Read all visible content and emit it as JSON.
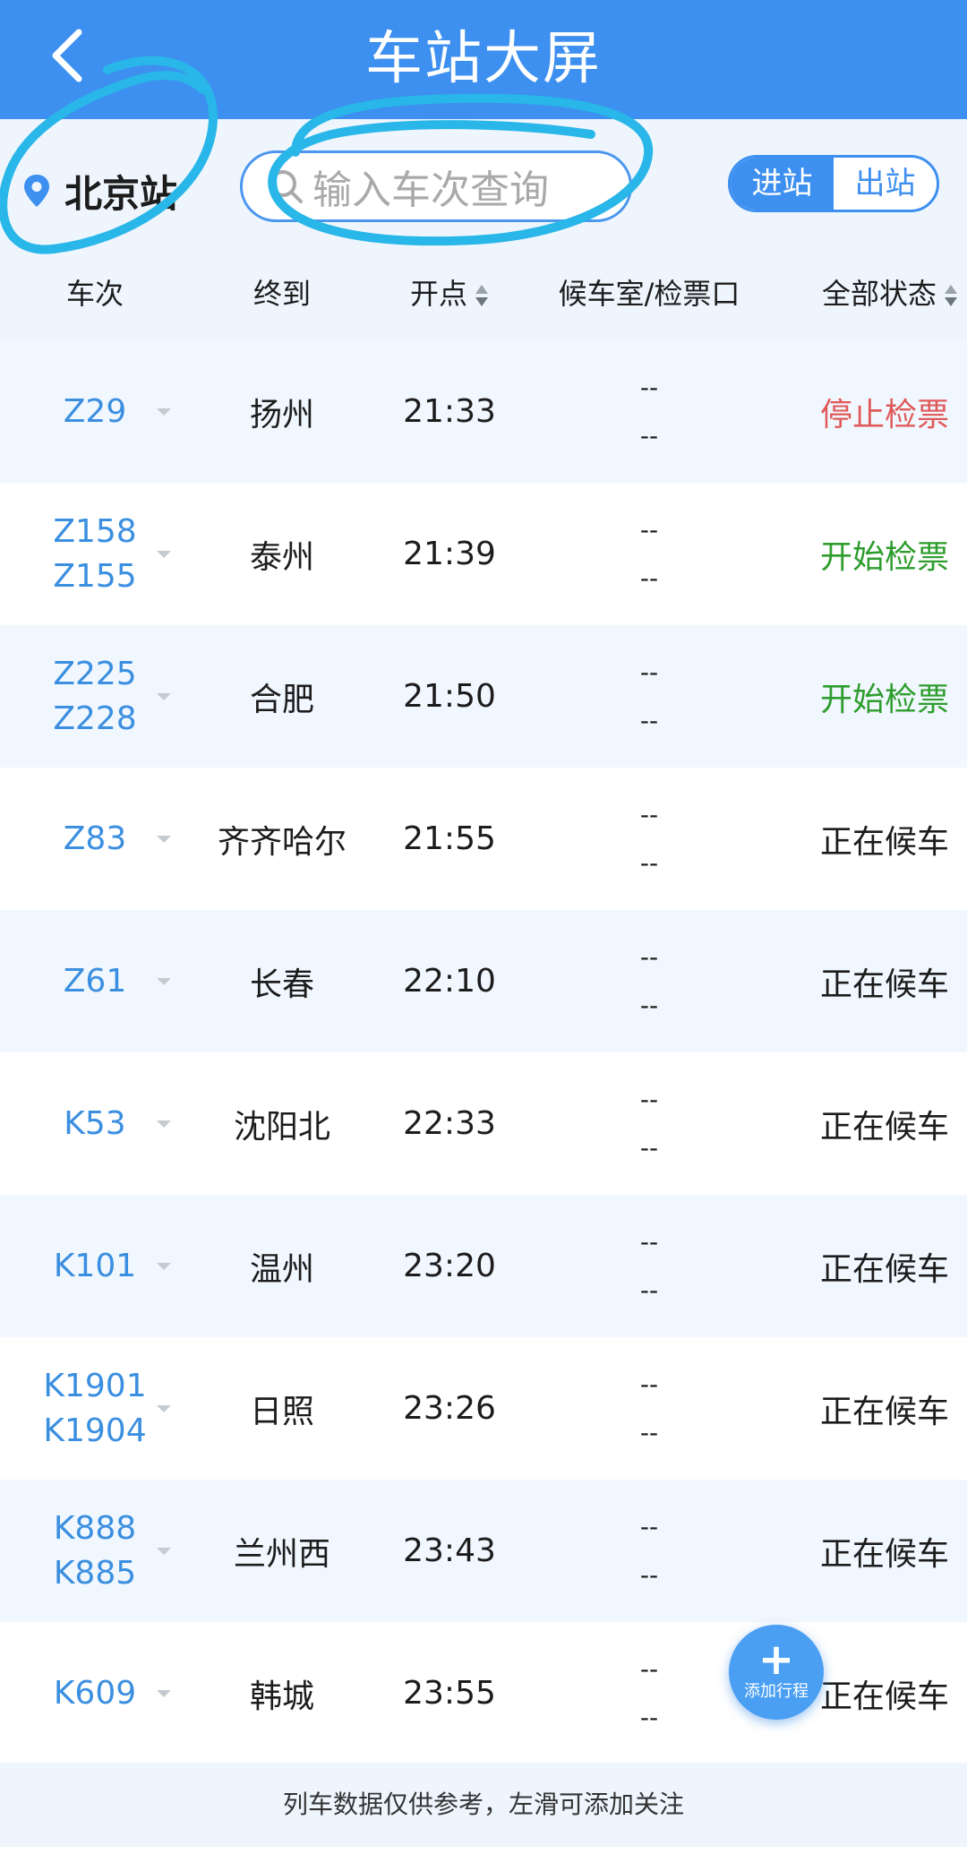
{
  "header": {
    "title": "车站大屏"
  },
  "toolbar": {
    "location": "北京站",
    "search_placeholder": "输入车次查询",
    "toggle": {
      "in": "进站",
      "out": "出站"
    }
  },
  "columns": {
    "train": "车次",
    "destination": "终到",
    "departure": "开点",
    "gate": "候车室/检票口",
    "status": "全部状态"
  },
  "rows": [
    {
      "train1": "Z29",
      "train2": "",
      "dest": "扬州",
      "time": "21:33",
      "gate1": "--",
      "gate2": "--",
      "status": "停止检票"
    },
    {
      "train1": "Z158",
      "train2": "Z155",
      "dest": "泰州",
      "time": "21:39",
      "gate1": "--",
      "gate2": "--",
      "status": "开始检票"
    },
    {
      "train1": "Z225",
      "train2": "Z228",
      "dest": "合肥",
      "time": "21:50",
      "gate1": "--",
      "gate2": "--",
      "status": "开始检票"
    },
    {
      "train1": "Z83",
      "train2": "",
      "dest": "齐齐哈尔",
      "time": "21:55",
      "gate1": "--",
      "gate2": "--",
      "status": "正在候车"
    },
    {
      "train1": "Z61",
      "train2": "",
      "dest": "长春",
      "time": "22:10",
      "gate1": "--",
      "gate2": "--",
      "status": "正在候车"
    },
    {
      "train1": "K53",
      "train2": "",
      "dest": "沈阳北",
      "time": "22:33",
      "gate1": "--",
      "gate2": "--",
      "status": "正在候车"
    },
    {
      "train1": "K101",
      "train2": "",
      "dest": "温州",
      "time": "23:20",
      "gate1": "--",
      "gate2": "--",
      "status": "正在候车"
    },
    {
      "train1": "K1901",
      "train2": "K1904",
      "dest": "日照",
      "time": "23:26",
      "gate1": "--",
      "gate2": "--",
      "status": "正在候车"
    },
    {
      "train1": "K888",
      "train2": "K885",
      "dest": "兰州西",
      "time": "23:43",
      "gate1": "--",
      "gate2": "--",
      "status": "正在候车"
    },
    {
      "train1": "K609",
      "train2": "",
      "dest": "韩城",
      "time": "23:55",
      "gate1": "--",
      "gate2": "--",
      "status": "正在候车"
    }
  ],
  "footer": {
    "note": "列车数据仅供参考，左滑可添加关注"
  },
  "fab": {
    "plus": "+",
    "label": "添加行程"
  },
  "colors": {
    "primary": "#3d8ff0",
    "stop_check": "#e05a5a",
    "start_check": "#2e9d2e",
    "train_number": "#3b8fe0",
    "annotation": "#29b6e8"
  },
  "icons": {
    "back": "chevron-left-icon",
    "location": "location-pin-icon",
    "search": "search-icon",
    "sort": "sort-icon",
    "row_caret": "caret-down-icon"
  }
}
